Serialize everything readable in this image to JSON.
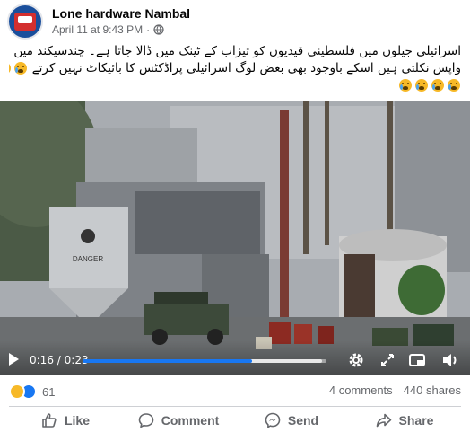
{
  "post": {
    "page_name": "Lone hardware Nambal",
    "timestamp": "April 11 at 9:43 PM",
    "separator": "·",
    "privacy_icon": "globe-icon",
    "caption_line1": "اسرائیلی جیلوں میں فلسطینی قیدیوں کو تیزاب کے ٹینک میں ڈالا جاتا ہے۔ چندسیکند میں ہڈیاں",
    "caption_line2": "واپس نکلتی ہیں اسکے باوجود بھی بعض لوگ اسرائیلی پراڈکٹس کا بائیکاٹ نہیں کرتے",
    "caption_emoji_count": 7
  },
  "video": {
    "current_time": "0:16",
    "separator": "/",
    "duration": "0:23",
    "progress_fraction": 0.695,
    "buffer_fraction": 0.98,
    "sign_text": "DANGER"
  },
  "stats": {
    "reaction_types": [
      "sad",
      "like"
    ],
    "reaction_count": "61",
    "comments": "4 comments",
    "shares": "440 shares"
  },
  "actions": {
    "like": "Like",
    "comment": "Comment",
    "send": "Send",
    "share": "Share"
  },
  "colors": {
    "accent": "#1877f2",
    "secondary_text": "#65676b",
    "reaction_sad": "#f7b928"
  }
}
